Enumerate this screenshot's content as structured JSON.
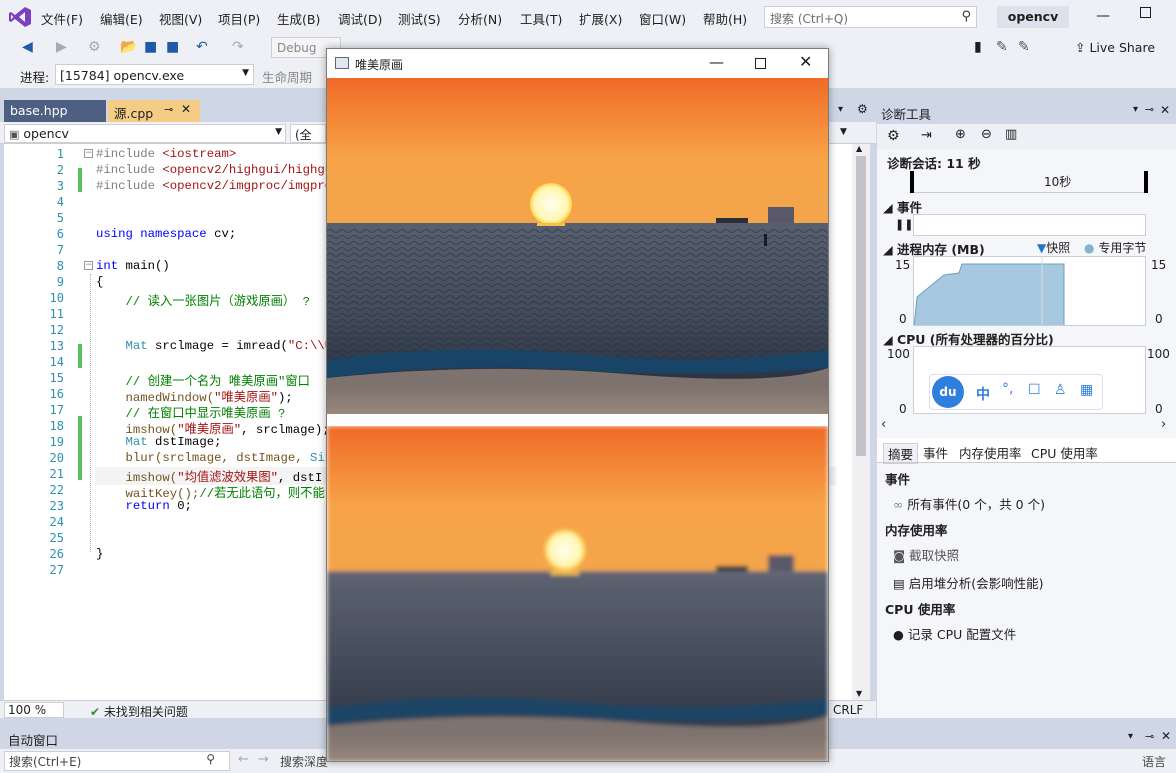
{
  "menu": {
    "items": [
      "文件(F)",
      "编辑(E)",
      "视图(V)",
      "项目(P)",
      "生成(B)",
      "调试(D)",
      "测试(S)",
      "分析(N)",
      "工具(T)",
      "扩展(X)",
      "窗口(W)",
      "帮助(H)"
    ],
    "search_placeholder": "搜索 (Ctrl+Q)",
    "solution_name": "opencv"
  },
  "toolbar": {
    "config": "Debug",
    "live_share": "Live Share",
    "process_label": "进程:",
    "process_value": "[15784] opencv.exe",
    "lifecycle": "生命周期"
  },
  "tabs": {
    "tab1": "base.hpp",
    "tab2": "源.cpp",
    "scope": "opencv",
    "scope2": "(全"
  },
  "editor": {
    "line_numbers": [
      "1",
      "2",
      "3",
      "4",
      "5",
      "6",
      "7",
      "8",
      "9",
      "10",
      "11",
      "12",
      "13",
      "14",
      "15",
      "16",
      "17",
      "18",
      "19",
      "20",
      "21",
      "22",
      "23",
      "24",
      "25",
      "26",
      "27"
    ],
    "zoom": "100 %",
    "issues": "未找到相关问题",
    "eol": "CRLF"
  },
  "code": {
    "l1a": "#include ",
    "l1b": "<iostream>",
    "l2a": "#include ",
    "l2b": "<opencv2/highgui/highgui",
    "l3a": "#include ",
    "l3b": "<opencv2/imgproc/imgproc",
    "l6a": "using namespace ",
    "l6b": "cv;",
    "l8a": "int ",
    "l8b": "main()",
    "l9": "{",
    "l10": "    // 读入一张图片（游戏原画） ?",
    "l13a": "    ",
    "l13b": "Mat",
    "l13c": " srclmage = imread(",
    "l13d": "\"C:\\\\Us",
    "l15": "    // 创建一个名为 唯美原画\"窗口",
    "l16a": "    namedWindow(",
    "l16b": "\"唯美原画\"",
    "l16c": ");",
    "l17": "    // 在窗口中显示唯美原画 ?",
    "l18a": "    imshow(",
    "l18b": "\"唯美原画\"",
    "l18c": ", srclmage);",
    "l19a": "    ",
    "l19b": "Mat",
    "l19c": " dstImage;",
    "l20a": "    blur(srclmage, dstImage, ",
    "l20b": "Size",
    "l21a": "    imshow(",
    "l21b": "\"均值滤波效果图\"",
    "l21c": ", dstI",
    "l22a": "    waitKey();",
    "l22b": "//若无此语句，则不能",
    "l23a": "    ",
    "l23b": "return",
    "l23c": " 0;",
    "l26": "}"
  },
  "diag": {
    "title": "诊断工具",
    "session": "诊断会话: 11 秒",
    "time_tick": "10秒",
    "events": "事件",
    "memory": "进程内存 (MB)",
    "snapshot": "快照",
    "private_bytes": "专用字节",
    "mem_max": "15",
    "mem_min": "0",
    "cpu": "CPU (所有处理器的百分比)",
    "cpu_max": "100",
    "cpu_min": "0",
    "tab_summary": "摘要",
    "tab_events": "事件",
    "tab_mem": "内存使用率",
    "tab_cpu": "CPU 使用率",
    "sec_events": "事件",
    "all_events": "所有事件(0 个，共 0 个)",
    "sec_mem": "内存使用率",
    "take_snapshot": "截取快照",
    "heap_profile": "启用堆分析(会影响性能)",
    "sec_cpu": "CPU 使用率",
    "record_cpu": "记录 CPU 配置文件",
    "ime_zh": "中",
    "ime_du": "du"
  },
  "bottom": {
    "title": "自动窗口",
    "search": "搜索(Ctrl+E)",
    "depth": "搜索深度",
    "lang": "语言"
  },
  "cvwindow": {
    "title": "唯美原画"
  }
}
